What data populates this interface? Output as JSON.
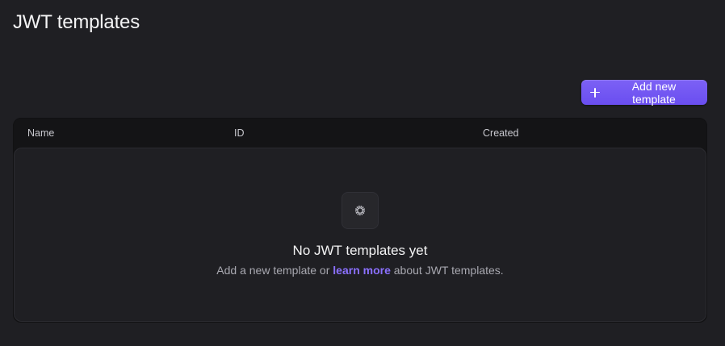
{
  "page": {
    "title": "JWT templates"
  },
  "toolbar": {
    "add_label": "Add new template",
    "accent_color": "#6c4ff2"
  },
  "table": {
    "columns": [
      "Name",
      "ID",
      "Created"
    ],
    "rows": []
  },
  "empty_state": {
    "icon": "gear-icon",
    "title": "No JWT templates yet",
    "text_before": "Add a new template or",
    "link_text": "learn more",
    "text_after": "about JWT templates.",
    "link_color": "#8b70ff"
  }
}
